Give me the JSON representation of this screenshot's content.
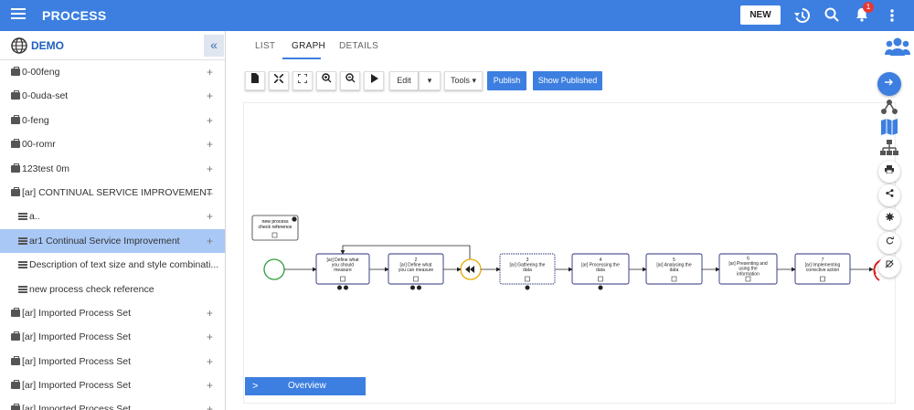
{
  "header": {
    "title": "PROCESS",
    "new_label": "NEW",
    "notification_count": "1",
    "icons": [
      "menu-icon",
      "history-icon",
      "search-icon",
      "bell-icon",
      "more-vert-icon"
    ]
  },
  "sidebar": {
    "title": "DEMO",
    "collapse_icon": "«",
    "items": [
      {
        "label": "0-00feng",
        "icon": "briefcase",
        "indent": 0,
        "expand": "+"
      },
      {
        "label": "0-0uda-set",
        "icon": "briefcase",
        "indent": 0,
        "expand": "+"
      },
      {
        "label": "0-feng",
        "icon": "briefcase",
        "indent": 0,
        "expand": "+"
      },
      {
        "label": "00-romr",
        "icon": "briefcase",
        "indent": 0,
        "expand": "+"
      },
      {
        "label": "123test 0m",
        "icon": "briefcase",
        "indent": 0,
        "expand": "+"
      },
      {
        "label": "[ar] CONTINUAL SERVICE IMPROVEMENT",
        "icon": "briefcase",
        "indent": 0,
        "expand": "–"
      },
      {
        "label": "a..",
        "icon": "list",
        "indent": 1,
        "expand": "+"
      },
      {
        "label": "ar1 Continual Service Improvement",
        "icon": "list",
        "indent": 1,
        "expand": "+",
        "selected": true
      },
      {
        "label": "Description of text size and style combinati...",
        "icon": "list",
        "indent": 1,
        "expand": ""
      },
      {
        "label": "new process check reference",
        "icon": "list",
        "indent": 1,
        "expand": ""
      },
      {
        "label": "[ar] Imported Process Set",
        "icon": "briefcase",
        "indent": 0,
        "expand": "+"
      },
      {
        "label": "[ar] Imported Process Set",
        "icon": "briefcase",
        "indent": 0,
        "expand": "+"
      },
      {
        "label": "[ar] Imported Process Set",
        "icon": "briefcase",
        "indent": 0,
        "expand": "+"
      },
      {
        "label": "[ar] Imported Process Set",
        "icon": "briefcase",
        "indent": 0,
        "expand": "+"
      },
      {
        "label": "[ar] Imported Process Set",
        "icon": "briefcase",
        "indent": 0,
        "expand": "+"
      }
    ]
  },
  "tabs": [
    {
      "label": "LIST",
      "active": false
    },
    {
      "label": "GRAPH",
      "active": true
    },
    {
      "label": "DETAILS",
      "active": false
    }
  ],
  "toolbar": {
    "edit_label": "Edit",
    "tools_label": "Tools ▾",
    "publish_label": "Publish",
    "show_published_label": "Show Published",
    "dropdown_caret": "▾"
  },
  "diagram": {
    "note": {
      "line1": "new process",
      "line2": "check reference"
    },
    "activities": [
      {
        "number": "",
        "lines": [
          "[ar] Define what",
          "you should",
          "measure"
        ]
      },
      {
        "number": "2",
        "lines": [
          "[ar] Define what",
          "you can measure"
        ]
      },
      {
        "number": "3",
        "lines": [
          "[ar] Gathering the",
          "data"
        ]
      },
      {
        "number": "4",
        "lines": [
          "[ar] Processing the",
          "data"
        ]
      },
      {
        "number": "5",
        "lines": [
          "[ar] Analysing the",
          "data"
        ]
      },
      {
        "number": "6",
        "lines": [
          "[ar] Presenting and",
          "using the",
          "information"
        ]
      },
      {
        "number": "7",
        "lines": [
          "[ar] Implementing",
          "corrective action"
        ]
      }
    ]
  },
  "overview_label": "Overview",
  "colors": {
    "primary": "#3d7fe0",
    "selected": "#a9c8f5",
    "start_event": "#2e9e3a",
    "end_event": "#e02020",
    "gateway": "#e8a900",
    "task_border": "#2a2f7a"
  }
}
